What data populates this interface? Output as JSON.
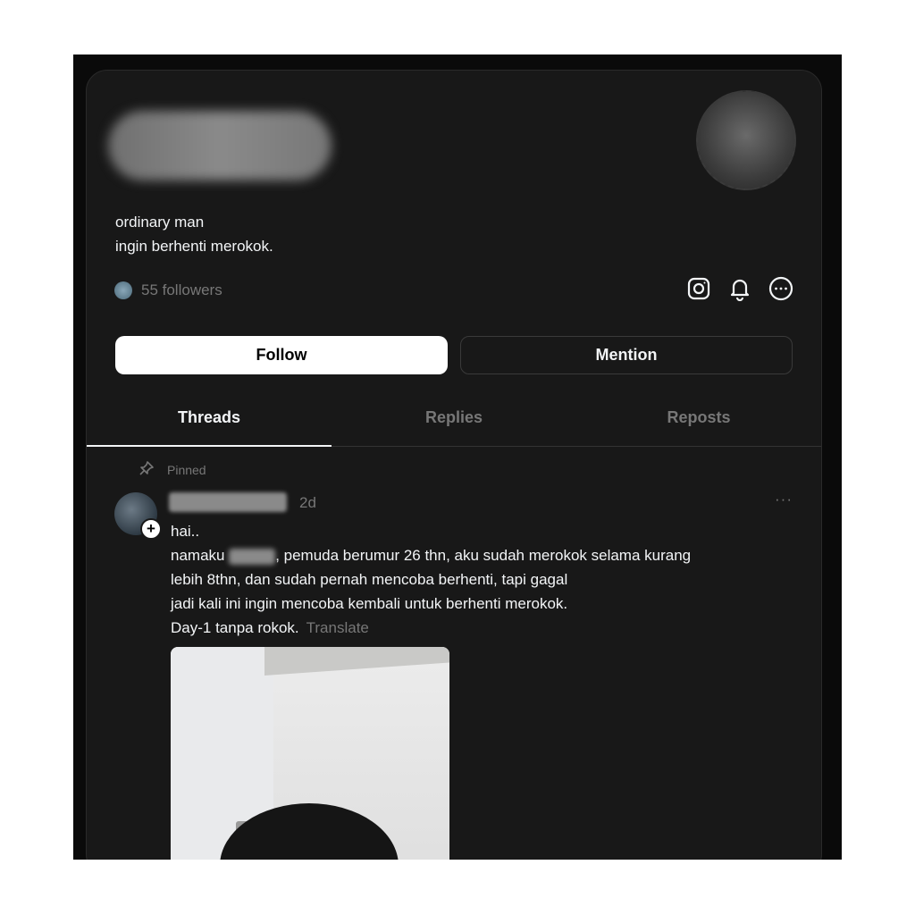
{
  "profile": {
    "bio_line1": "ordinary man",
    "bio_line2": "ingin berhenti merokok.",
    "followers_text": "55 followers"
  },
  "header_icons": [
    "instagram-icon",
    "bell-icon",
    "more-options-icon"
  ],
  "buttons": {
    "follow": "Follow",
    "mention": "Mention"
  },
  "tabs": [
    {
      "label": "Threads",
      "active": true
    },
    {
      "label": "Replies",
      "active": false
    },
    {
      "label": "Reposts",
      "active": false
    }
  ],
  "post": {
    "pinned_label": "Pinned",
    "time": "2d",
    "more": "···",
    "line1": "hai..",
    "line2_before": "namaku ",
    "line2_after": ", pemuda berumur 26 thn, aku sudah merokok selama kurang",
    "line3": "lebih 8thn, dan sudah pernah mencoba berhenti, tapi gagal",
    "line4": "jadi kali ini ingin mencoba kembali untuk berhenti merokok.",
    "line5": "Day-1 tanpa rokok.",
    "translate": "Translate"
  },
  "colors": {
    "background": "#181818",
    "text": "#f3f5f7",
    "muted": "#777777",
    "button_primary": "#ffffff"
  }
}
